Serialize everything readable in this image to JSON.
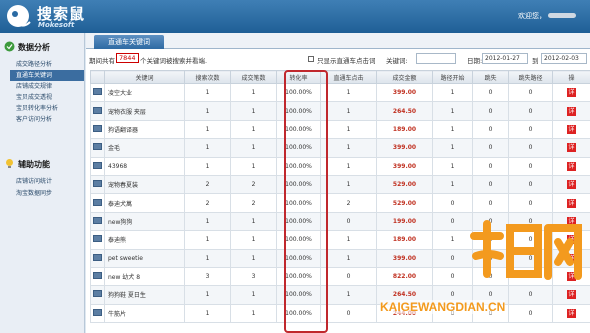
{
  "header": {
    "app_name": "搜索鼠",
    "app_sub": "Mokesoft",
    "welcome": "欢迎您，"
  },
  "sidebar": {
    "section1_title": "数据分析",
    "section1_items": [
      "成交路径分析",
      "直通车关键词",
      "店铺成交规律",
      "宝贝成交透视",
      "宝贝转化率分析",
      "客户访问分析"
    ],
    "section2_title": "辅助功能",
    "section2_items": [
      "店铺访问统计",
      "淘宝数据同步"
    ]
  },
  "main": {
    "tab": "直通车关键词",
    "filter": {
      "prefix": "期间共有",
      "count": "7844",
      "suffix": "个关键词被搜索并看端.",
      "only_show_label": "只显示直通车点击词",
      "keyword_label": "关键词:",
      "date_label": "日期:",
      "date_from": "2012-01-27",
      "to_label": "到",
      "date_to": "2012-02-03"
    },
    "columns": [
      "",
      "关键词",
      "搜索次数",
      "成交笔数",
      "转化率",
      "直通车点击",
      "成交金额",
      "路径开始",
      "跳失",
      "跳失路径",
      "操"
    ],
    "rows": [
      [
        "凌空大业",
        "1",
        "1",
        "100.00%",
        "1",
        "399.00",
        "1",
        "0",
        "0"
      ],
      [
        "宠物衣服 夹层",
        "1",
        "1",
        "100.00%",
        "1",
        "264.50",
        "1",
        "0",
        "0"
      ],
      [
        "狗语翻译器",
        "1",
        "1",
        "100.00%",
        "1",
        "189.00",
        "1",
        "0",
        "0"
      ],
      [
        "金毛",
        "1",
        "1",
        "100.00%",
        "1",
        "399.00",
        "1",
        "0",
        "0"
      ],
      [
        "43968",
        "1",
        "1",
        "100.00%",
        "1",
        "399.00",
        "1",
        "0",
        "0"
      ],
      [
        "宠物春夏装",
        "2",
        "2",
        "100.00%",
        "1",
        "529.00",
        "1",
        "0",
        "0"
      ],
      [
        "泰迪犬萬",
        "2",
        "2",
        "100.00%",
        "2",
        "529.00",
        "0",
        "0",
        "0"
      ],
      [
        "new狗狗",
        "1",
        "1",
        "100.00%",
        "0",
        "199.00",
        "0",
        "0",
        "0"
      ],
      [
        "泰迪熊",
        "1",
        "1",
        "100.00%",
        "1",
        "189.00",
        "1",
        "0",
        "0"
      ],
      [
        "pet sweetie",
        "1",
        "1",
        "100.00%",
        "1",
        "399.00",
        "0",
        "0",
        "0"
      ],
      [
        "new 幼犬 8",
        "3",
        "3",
        "100.00%",
        "0",
        "822.00",
        "0",
        "0",
        "0"
      ],
      [
        "狗狗鞋 夏日生",
        "1",
        "1",
        "100.00%",
        "1",
        "264.50",
        "0",
        "0",
        "0"
      ],
      [
        "牛筋片",
        "1",
        "1",
        "100.00%",
        "0",
        "244.00",
        "0",
        "0",
        "0"
      ]
    ],
    "action_label": "详"
  },
  "watermark": {
    "logo_text": "开店网",
    "url": "KAIGEWANGDIAN.CN"
  },
  "colors": {
    "topbar": "#2a6aa3",
    "highlight": "#c0282d",
    "amount": "#c03020",
    "watermark": "#f39a1e"
  }
}
